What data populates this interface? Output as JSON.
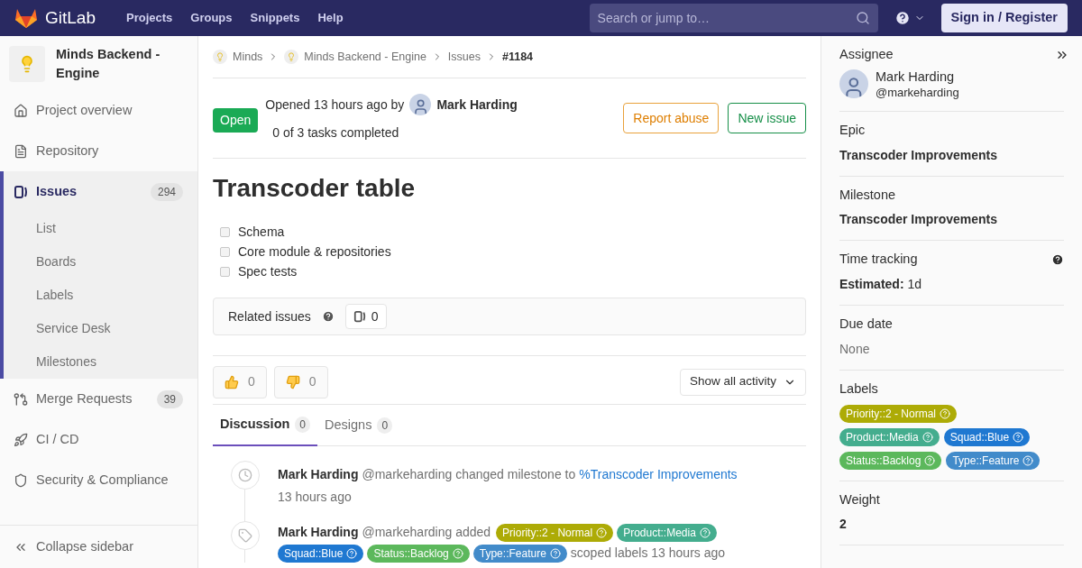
{
  "header": {
    "logo_text": "GitLab",
    "nav": [
      "Projects",
      "Groups",
      "Snippets",
      "Help"
    ],
    "search": {
      "placeholder": "Search or jump to…"
    },
    "sign_in": "Sign in / Register"
  },
  "sidebar": {
    "project_name": "Minds Backend - Engine",
    "items": [
      {
        "label": "Project overview",
        "kind": "home",
        "selected": false
      },
      {
        "label": "Repository",
        "kind": "file",
        "selected": false
      },
      {
        "label": "Issues",
        "kind": "issues",
        "selected": true,
        "count": "294",
        "children": [
          {
            "label": "List",
            "selected": false
          },
          {
            "label": "Boards",
            "selected": false
          },
          {
            "label": "Labels",
            "selected": false
          },
          {
            "label": "Service Desk",
            "selected": false
          },
          {
            "label": "Milestones",
            "selected": false
          }
        ]
      },
      {
        "label": "Merge Requests",
        "kind": "merge",
        "selected": false,
        "count": "39"
      },
      {
        "label": "CI / CD",
        "kind": "rocket",
        "selected": false
      },
      {
        "label": "Security & Compliance",
        "kind": "shield",
        "selected": false
      }
    ],
    "collapse": "Collapse sidebar"
  },
  "breadcrumbs": [
    {
      "label": "Minds",
      "avatar": true,
      "current": false
    },
    {
      "label": "Minds Backend - Engine",
      "avatar": true,
      "current": false
    },
    {
      "label": "Issues",
      "avatar": false,
      "current": false
    },
    {
      "label": "#1184",
      "avatar": false,
      "current": true
    }
  ],
  "issue": {
    "status": "Open",
    "opened": "Opened 13 hours ago by",
    "author": "Mark Harding",
    "tasks_summary": "0 of 3 tasks completed",
    "buttons": [
      {
        "label": "Report abuse",
        "kind": "warning"
      },
      {
        "label": "New issue",
        "kind": "success"
      }
    ],
    "title": "Transcoder table",
    "tasks": [
      {
        "label": "Schema",
        "checked": false
      },
      {
        "label": "Core module & repositories",
        "checked": false
      },
      {
        "label": "Spec tests",
        "checked": false
      }
    ],
    "related": {
      "label": "Related issues",
      "count": "0"
    },
    "awards": [
      {
        "kind": "thumbsup",
        "count": "0"
      },
      {
        "kind": "thumbsdown",
        "count": "0"
      }
    ],
    "activity_filter": "Show all activity"
  },
  "tabs": [
    {
      "label": "Discussion",
      "count": "0",
      "selected": true
    },
    {
      "label": "Designs",
      "count": "0",
      "selected": false
    }
  ],
  "notes": [
    {
      "kind": "milestone",
      "author": "Mark Harding",
      "text": "@markeharding changed milestone to",
      "link": "%Transcoder Improvements",
      "time": "13 hours ago"
    },
    {
      "kind": "labels",
      "author": "Mark Harding",
      "text": "@markeharding added",
      "labels": [
        {
          "name": "Priority::2 - Normal",
          "color": "#adab06"
        },
        {
          "name": "Product::Media",
          "color": "#44ad8e"
        },
        {
          "name": "Squad::Blue",
          "color": "#1f78d1"
        },
        {
          "name": "Status::Backlog",
          "color": "#5cb85c"
        },
        {
          "name": "Type::Feature",
          "color": "#428bca"
        }
      ],
      "after": "scoped labels 13 hours ago"
    }
  ],
  "right_sidebar": {
    "assignee": {
      "label": "Assignee",
      "name": "Mark Harding",
      "handle": "@markeharding"
    },
    "epic": {
      "label": "Epic",
      "value": "Transcoder Improvements"
    },
    "milestone": {
      "label": "Milestone",
      "value": "Transcoder Improvements"
    },
    "time_tracking": {
      "label": "Time tracking",
      "estimate_label": "Estimated:",
      "estimate": "1d"
    },
    "due_date": {
      "label": "Due date",
      "value": "None"
    },
    "labels": {
      "label": "Labels",
      "items": [
        {
          "name": "Priority::2 - Normal",
          "color": "#adab06"
        },
        {
          "name": "Product::Media",
          "color": "#44ad8e"
        },
        {
          "name": "Squad::Blue",
          "color": "#1f78d1"
        },
        {
          "name": "Status::Backlog",
          "color": "#5cb85c"
        },
        {
          "name": "Type::Feature",
          "color": "#428bca"
        }
      ]
    },
    "weight": {
      "label": "Weight",
      "value": "2"
    }
  }
}
